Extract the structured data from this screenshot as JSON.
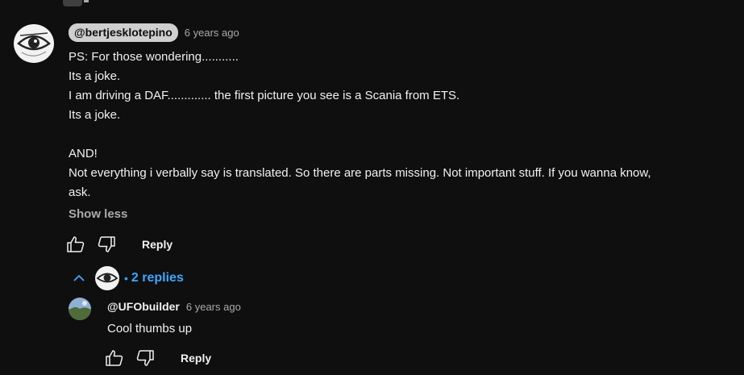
{
  "comment": {
    "author": "@bertjesklotepino",
    "timestamp": "6 years ago",
    "body": "PS: For those wondering...........\nIts a joke.\nI am driving a DAF............. the first picture you see is a Scania from ETS.\nIts a joke.\n\nAND!\nNot everything i verbally say is translated. So there are parts missing. Not important stuff. If you wanna know,\nask.",
    "show_less_label": "Show less",
    "reply_label": "Reply",
    "icons": {
      "like": "thumb-up-icon",
      "dislike": "thumb-down-icon"
    }
  },
  "replies_toggle": {
    "count_label": "2 replies",
    "separator": "•",
    "icon": "chevron-up-icon",
    "accent_color": "#3ea6ff"
  },
  "reply": {
    "author": "@UFObuilder",
    "timestamp": "6 years ago",
    "body": "Cool thumbs up",
    "reply_label": "Reply"
  },
  "colors": {
    "background": "#0f0f0f",
    "text": "#f1f1f1",
    "secondary_text": "#aaaaaa",
    "author_chip_bg": "#cfcfcf"
  }
}
